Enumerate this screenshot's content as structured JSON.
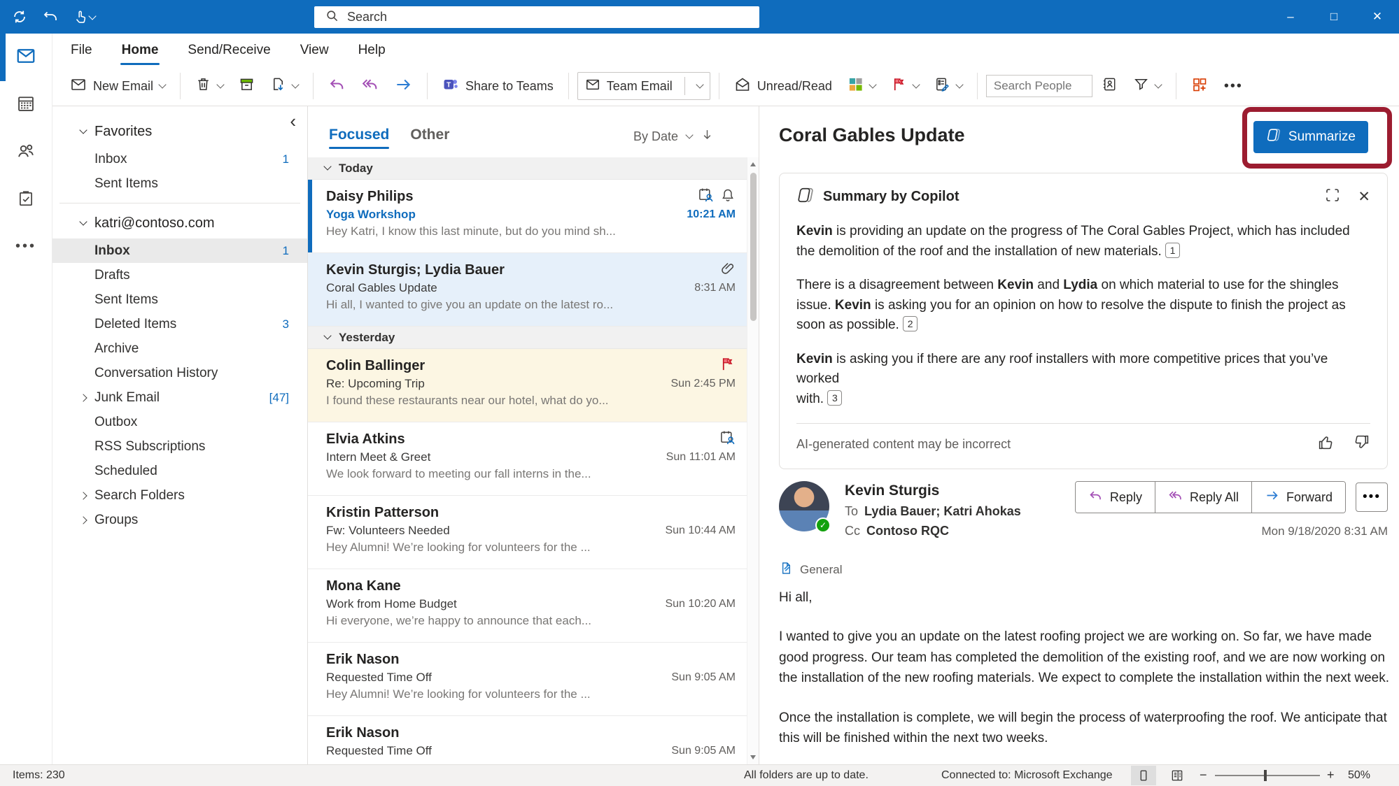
{
  "colors": {
    "accent": "#0f6cbd",
    "annotation_red": "#9c1c30",
    "flag_red": "#e74856"
  },
  "titlebar": {
    "search_placeholder": "Search"
  },
  "menu": {
    "tabs": [
      {
        "label": "File"
      },
      {
        "label": "Home",
        "active": true
      },
      {
        "label": "Send/Receive"
      },
      {
        "label": "View"
      },
      {
        "label": "Help"
      }
    ]
  },
  "ribbon": {
    "new_email": "New Email",
    "share_to_teams": "Share to Teams",
    "team_email": "Team Email",
    "unread_read": "Unread/Read",
    "search_people_placeholder": "Search People"
  },
  "folders": {
    "sections": [
      {
        "title": "Favorites",
        "items": [
          {
            "label": "Inbox",
            "count": "1"
          },
          {
            "label": "Sent Items"
          }
        ]
      },
      {
        "title": "katri@contoso.com",
        "items": [
          {
            "label": "Inbox",
            "count": "1",
            "selected": true
          },
          {
            "label": "Drafts"
          },
          {
            "label": "Sent Items"
          },
          {
            "label": "Deleted Items",
            "count": "3"
          },
          {
            "label": "Archive"
          },
          {
            "label": "Conversation History"
          },
          {
            "label": "Junk Email",
            "count": "[47]",
            "expandable": true
          },
          {
            "label": "Outbox"
          },
          {
            "label": "RSS Subscriptions"
          },
          {
            "label": "Scheduled"
          },
          {
            "label": "Search Folders",
            "expandable": true
          },
          {
            "label": "Groups",
            "expandable": true
          }
        ]
      }
    ]
  },
  "message_list": {
    "tabs": [
      {
        "label": "Focused",
        "active": true
      },
      {
        "label": "Other"
      }
    ],
    "sort_label": "By Date",
    "groups": [
      {
        "label": "Today",
        "items": [
          {
            "sender": "Daisy Philips",
            "subject": "Yoga Workshop",
            "preview": "Hey Katri, I know this last minute, but do you mind sh...",
            "time": "10:21 AM",
            "icons": [
              "meeting-icon",
              "bell-icon"
            ],
            "state": "unread"
          },
          {
            "sender": "Kevin Sturgis; Lydia Bauer",
            "subject": "Coral Gables Update",
            "preview": "Hi all, I wanted to give you an update on the latest ro...",
            "time": "8:31 AM",
            "icons": [
              "paperclip-icon"
            ],
            "state": "selected"
          }
        ]
      },
      {
        "label": "Yesterday",
        "items": [
          {
            "sender": "Colin Ballinger",
            "subject": "Re: Upcoming Trip",
            "preview": "I found these restaurants near our hotel, what do yo...",
            "time": "Sun 2:45 PM",
            "icons": [
              "flag-icon"
            ],
            "state": "flagged"
          },
          {
            "sender": "Elvia Atkins",
            "subject": "Intern Meet & Greet",
            "preview": "We look forward to meeting our fall interns in the...",
            "time": "Sun 11:01 AM",
            "icons": [
              "meeting-icon"
            ],
            "state": ""
          },
          {
            "sender": "Kristin Patterson",
            "subject": "Fw: Volunteers Needed",
            "preview": "Hey Alumni! We’re looking for volunteers for the ...",
            "time": "Sun 10:44 AM",
            "icons": [],
            "state": ""
          },
          {
            "sender": "Mona Kane",
            "subject": "Work from Home Budget",
            "preview": "Hi everyone, we’re happy to announce that each...",
            "time": "Sun 10:20 AM",
            "icons": [],
            "state": ""
          },
          {
            "sender": "Erik Nason",
            "subject": "Requested Time Off",
            "preview": "Hey Alumni! We’re looking for volunteers for the ...",
            "time": "Sun 9:05 AM",
            "icons": [],
            "state": ""
          },
          {
            "sender": "Erik Nason",
            "subject": "Requested Time Off",
            "preview": "",
            "time": "Sun 9:05 AM",
            "icons": [],
            "state": ""
          }
        ]
      }
    ]
  },
  "reading_pane": {
    "subject": "Coral Gables Update",
    "summarize_label": "Summarize",
    "summary": {
      "title": "Summary by Copilot",
      "paragraphs": [
        {
          "parts": [
            {
              "b": "Kevin"
            },
            {
              "t": " is providing an update on the progress of The Coral Gables Project, which has included the demolition of the roof and the installation of new materials. "
            }
          ],
          "cite": "1"
        },
        {
          "parts": [
            {
              "t": "There is a disagreement between "
            },
            {
              "b": "Kevin"
            },
            {
              "t": " and "
            },
            {
              "b": "Lydia"
            },
            {
              "t": " on which material to use for the shingles issue. "
            },
            {
              "b": "Kevin"
            },
            {
              "t": " is asking you for an opinion on how to resolve the dispute to finish the project as soon as possible. "
            }
          ],
          "cite": "2"
        },
        {
          "parts": [
            {
              "b": "Kevin"
            },
            {
              "t": " is asking you if there are any roof installers with more competitive prices that you’ve worked"
            },
            {
              "br": true
            },
            {
              "t": "with. "
            }
          ],
          "cite": "3"
        }
      ],
      "disclaimer": "AI-generated content may be incorrect"
    },
    "message": {
      "sender": "Kevin Sturgis",
      "to_label": "To",
      "to": "Lydia Bauer; Katri Ahokas",
      "cc_label": "Cc",
      "cc": "Contoso RQC",
      "reply_label": "Reply",
      "reply_all_label": "Reply All",
      "forward_label": "Forward",
      "date": "Mon 9/18/2020 8:31 AM",
      "sensitivity_label": "General",
      "body": [
        "Hi all,",
        "I wanted to give you an update on the latest roofing project we are working on. So far, we have made good progress. Our team has completed the demolition of the existing roof, and we are now working on the installation of the new roofing materials. We expect to complete the installation within the next week.",
        "Once the installation is complete, we will begin the process of waterproofing the roof. We anticipate that this will be finished within the next two weeks."
      ]
    }
  },
  "status_bar": {
    "items": "Items: 230",
    "sync": "All folders are up to date.",
    "connection": "Connected to: Microsoft Exchange",
    "zoom": "50%"
  }
}
